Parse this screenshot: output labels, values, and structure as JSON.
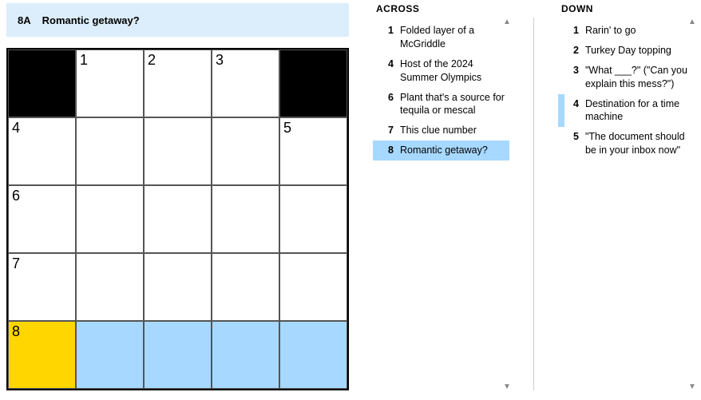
{
  "current_clue": {
    "label": "8A",
    "text": "Romantic getaway?"
  },
  "grid": [
    [
      {
        "type": "black"
      },
      {
        "type": "cell",
        "num": "1"
      },
      {
        "type": "cell",
        "num": "2"
      },
      {
        "type": "cell",
        "num": "3"
      },
      {
        "type": "black"
      }
    ],
    [
      {
        "type": "cell",
        "num": "4"
      },
      {
        "type": "cell"
      },
      {
        "type": "cell"
      },
      {
        "type": "cell"
      },
      {
        "type": "cell",
        "num": "5"
      }
    ],
    [
      {
        "type": "cell",
        "num": "6"
      },
      {
        "type": "cell"
      },
      {
        "type": "cell"
      },
      {
        "type": "cell"
      },
      {
        "type": "cell"
      }
    ],
    [
      {
        "type": "cell",
        "num": "7"
      },
      {
        "type": "cell"
      },
      {
        "type": "cell"
      },
      {
        "type": "cell"
      },
      {
        "type": "cell"
      }
    ],
    [
      {
        "type": "cell",
        "num": "8",
        "hl": "yellow"
      },
      {
        "type": "cell",
        "hl": "blue"
      },
      {
        "type": "cell",
        "hl": "blue"
      },
      {
        "type": "cell",
        "hl": "blue"
      },
      {
        "type": "cell",
        "hl": "blue"
      }
    ]
  ],
  "across": {
    "header": "ACROSS",
    "clues": [
      {
        "num": "1",
        "text": "Folded layer of a McGriddle"
      },
      {
        "num": "4",
        "text": "Host of the 2024 Summer Olympics"
      },
      {
        "num": "6",
        "text": "Plant that's a source for tequila or mescal"
      },
      {
        "num": "7",
        "text": "This clue number"
      },
      {
        "num": "8",
        "text": "Romantic getaway?",
        "active": true
      }
    ]
  },
  "down": {
    "header": "DOWN",
    "clues": [
      {
        "num": "1",
        "text": "Rarin' to go"
      },
      {
        "num": "2",
        "text": "Turkey Day topping"
      },
      {
        "num": "3",
        "text": "\"What ___?\" (\"Can you explain this mess?\")"
      },
      {
        "num": "4",
        "text": "Destination for a time machine",
        "related": true
      },
      {
        "num": "5",
        "text": "\"The document should be in your inbox now\""
      }
    ]
  },
  "icons": {
    "up": "▲",
    "down": "▼"
  }
}
